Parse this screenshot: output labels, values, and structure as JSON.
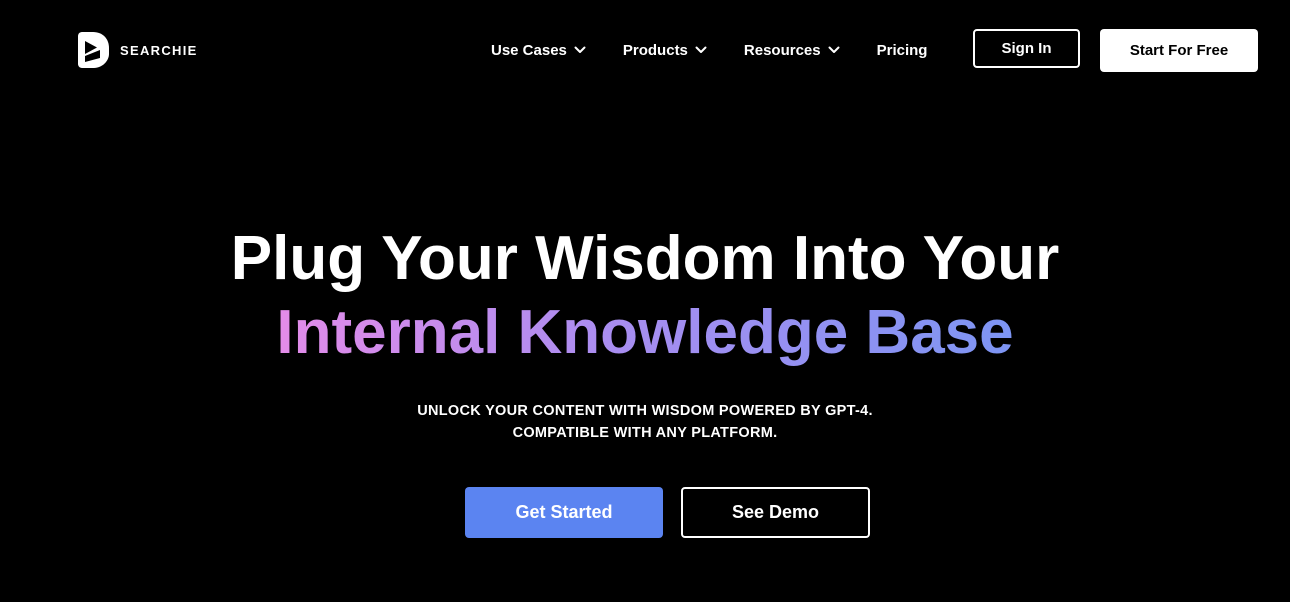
{
  "brand": {
    "name": "SEARCHIE",
    "logo_icon": "searchie-play-icon"
  },
  "nav": {
    "items": [
      {
        "label": "Use Cases",
        "has_dropdown": true
      },
      {
        "label": "Products",
        "has_dropdown": true
      },
      {
        "label": "Resources",
        "has_dropdown": true
      },
      {
        "label": "Pricing",
        "has_dropdown": false
      }
    ],
    "dropdown_icon": "chevron-down-icon"
  },
  "header_buttons": {
    "sign_in": "Sign In",
    "start_free": "Start For Free"
  },
  "hero": {
    "title_line1": "Plug Your Wisdom Into Your",
    "title_line2": "Internal Knowledge Base",
    "subhead_line1": "UNLOCK YOUR CONTENT WITH WISDOM POWERED BY GPT-4.",
    "subhead_line2": "COMPATIBLE WITH ANY PLATFORM.",
    "primary_cta": "Get Started",
    "secondary_cta": "See Demo"
  },
  "colors": {
    "background": "#000000",
    "text": "#ffffff",
    "primary_button": "#5b84f1",
    "gradient_start": "#e38ce9",
    "gradient_mid": "#a98df0",
    "gradient_end": "#7d95f3"
  }
}
